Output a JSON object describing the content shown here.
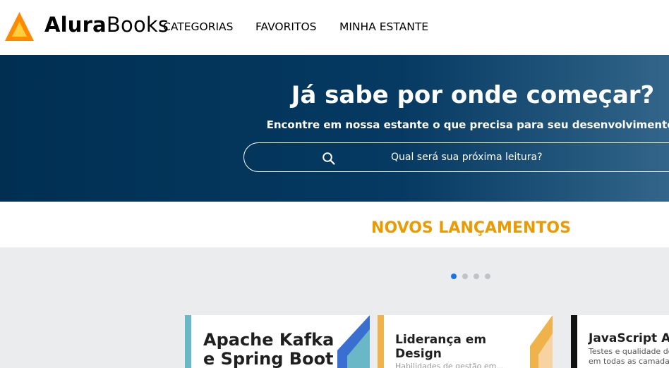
{
  "header": {
    "brand_part1": "Alura",
    "brand_part2": "Books",
    "nav": [
      "CATEGORIAS",
      "FAVORITOS",
      "MINHA ESTANTE"
    ]
  },
  "hero": {
    "title": "Já sabe por onde começar?",
    "subtitle": "Encontre em nossa estante o que precisa para seu desenvolvimento!",
    "search_placeholder": "Qual será sua próxima leitura?"
  },
  "section": {
    "title": "NOVOS LANÇAMENTOS"
  },
  "carousel": {
    "dots": 4,
    "active_dot": 0,
    "books": [
      {
        "title_line1": "Apache Kafka",
        "title_line2": "e Spring Boot",
        "subtitle": ""
      },
      {
        "title_line1": "Liderança em",
        "title_line2": "Design",
        "subtitle": "Habilidades de gestão em..."
      },
      {
        "title_line1": "JavaScript As",
        "title_line2": "",
        "subtitle": "Testes e qualidade de c",
        "subtitle2": "em todas as camadas d"
      }
    ]
  },
  "colors": {
    "hero_bg": "#002f52",
    "accent_orange": "#eb9b00",
    "logo_orange": "#ff8a00",
    "logo_yellow": "#ffcf3d",
    "dot_active": "#1a73e8",
    "dot_inactive": "#c1c3c7",
    "carousel_bg": "#ebecee"
  }
}
